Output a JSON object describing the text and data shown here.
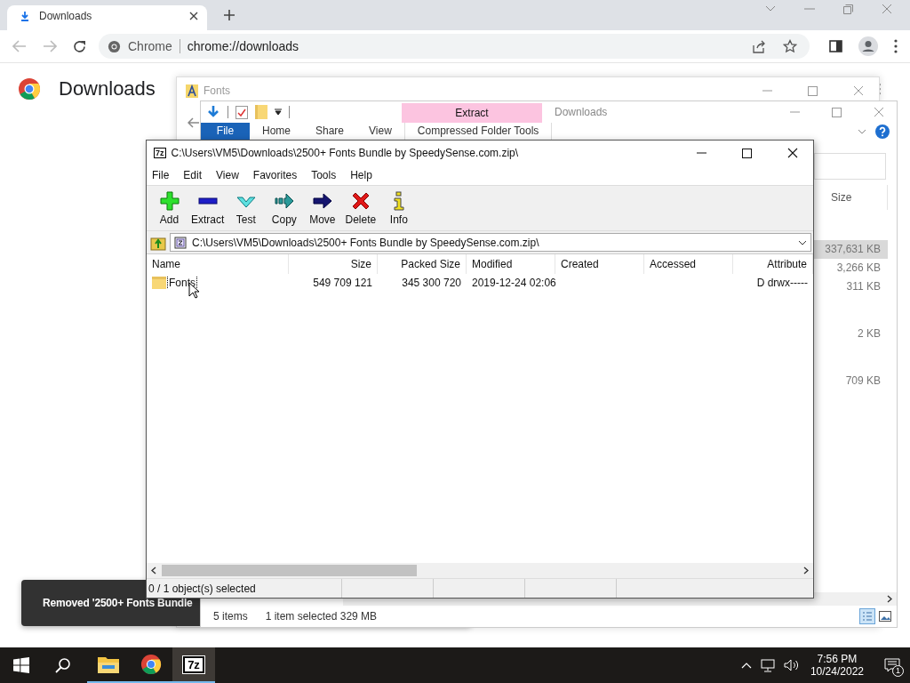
{
  "browser": {
    "tab_title": "Downloads",
    "site_label": "Chrome",
    "url": "chrome://downloads",
    "page_heading": "Downloads"
  },
  "fonts_window": {
    "title": "Fonts"
  },
  "downloads_window": {
    "context_tab": "Extract",
    "title": "Downloads",
    "ribbon_tabs": [
      {
        "label": "File",
        "selected": true
      },
      {
        "label": "Home",
        "selected": false
      },
      {
        "label": "Share",
        "selected": false
      },
      {
        "label": "View",
        "selected": false
      },
      {
        "label": "Compressed Folder Tools",
        "selected": false
      }
    ],
    "size_column": "Size",
    "sizes": [
      {
        "text": "337,631 KB",
        "selected": true
      },
      {
        "text": "3,266 KB",
        "selected": false
      },
      {
        "text": "311 KB",
        "selected": false
      },
      {
        "text": "2 KB",
        "selected": false
      },
      {
        "text": "709 KB",
        "selected": false
      }
    ],
    "status": {
      "item_count": "5 items",
      "selection": "1 item selected  329 MB"
    }
  },
  "archive_window": {
    "icon_label": "7z",
    "title": "C:\\Users\\VM5\\Downloads\\2500+ Fonts Bundle by SpeedySense.com.zip\\",
    "menu": [
      "File",
      "Edit",
      "View",
      "Favorites",
      "Tools",
      "Help"
    ],
    "toolbar": [
      {
        "kind": "add",
        "label": "Add"
      },
      {
        "kind": "extract",
        "label": "Extract"
      },
      {
        "kind": "test",
        "label": "Test"
      },
      {
        "kind": "copy",
        "label": "Copy"
      },
      {
        "kind": "move",
        "label": "Move"
      },
      {
        "kind": "delete",
        "label": "Delete"
      },
      {
        "kind": "info",
        "label": "Info"
      }
    ],
    "address": "C:\\Users\\VM5\\Downloads\\2500+ Fonts Bundle by SpeedySense.com.zip\\",
    "columns": [
      "Name",
      "Size",
      "Packed Size",
      "Modified",
      "Created",
      "Accessed",
      "Attribute"
    ],
    "rows": [
      {
        "name": "Fonts",
        "size": "549 709 121",
        "packed_size": "345 300 720",
        "modified": "2019-12-24 02:06",
        "attributes": "D drwx-----",
        "focused": true
      }
    ],
    "status": "0 / 1 object(s) selected"
  },
  "toast": {
    "message": "Removed '2500+ Fonts Bundle"
  },
  "taskbar": {
    "apps": [
      {
        "kind": "explorer",
        "active": false
      },
      {
        "kind": "chrome",
        "active": false
      },
      {
        "kind": "sevenzip",
        "label": "7z",
        "active": true
      }
    ],
    "time": "7:56 PM",
    "date": "10/24/2022",
    "notification_count": "1"
  }
}
